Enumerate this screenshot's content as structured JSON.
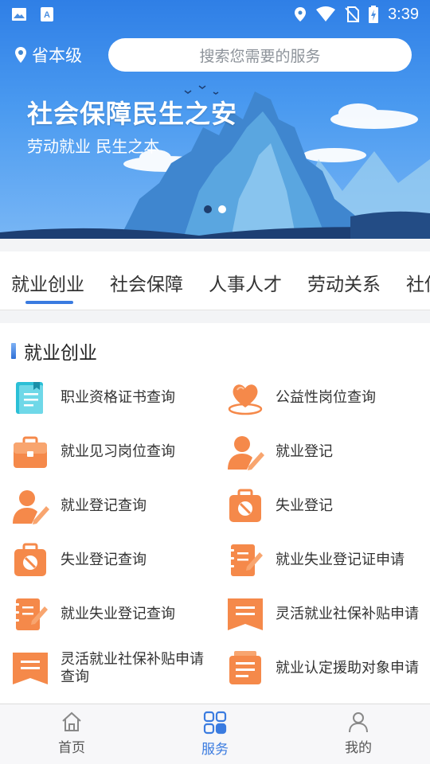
{
  "status_bar": {
    "time": "3:39"
  },
  "header": {
    "location": "省本级",
    "search_placeholder": "搜索您需要的服务"
  },
  "banner": {
    "title": "社会保障民生之安",
    "subtitle": "劳动就业 民生之本",
    "slide_count": 2,
    "active_slide": 1
  },
  "tabs": [
    "就业创业",
    "社会保障",
    "人事人才",
    "劳动关系",
    "社保"
  ],
  "active_tab": 0,
  "section": {
    "title": "就业创业",
    "items": [
      {
        "label": "职业资格证书查询",
        "icon": "certificate-icon",
        "color": "#2bbfd6"
      },
      {
        "label": "公益性岗位查询",
        "icon": "heart-hand-icon",
        "color": "#f5894a"
      },
      {
        "label": "就业见习岗位查询",
        "icon": "briefcase-icon",
        "color": "#f5894a"
      },
      {
        "label": "就业登记",
        "icon": "person-pen-icon",
        "color": "#f5894a"
      },
      {
        "label": "就业登记查询",
        "icon": "person-pen-icon",
        "color": "#f5894a"
      },
      {
        "label": "失业登记",
        "icon": "bag-block-icon",
        "color": "#f5894a"
      },
      {
        "label": "失业登记查询",
        "icon": "bag-block-icon",
        "color": "#f5894a"
      },
      {
        "label": "就业失业登记证申请",
        "icon": "notepad-pen-icon",
        "color": "#f5894a"
      },
      {
        "label": "就业失业登记查询",
        "icon": "notepad-pen-icon",
        "color": "#f5894a"
      },
      {
        "label": "灵活就业社保补贴申请",
        "icon": "bookmark-icon",
        "color": "#f5894a"
      },
      {
        "label": "灵活就业社保补贴申请查询",
        "icon": "bookmark-icon",
        "color": "#f5894a"
      },
      {
        "label": "就业认定援助对象申请",
        "icon": "document-stack-icon",
        "color": "#f5894a"
      }
    ]
  },
  "bottom_nav": [
    {
      "label": "首页",
      "icon": "home-icon"
    },
    {
      "label": "服务",
      "icon": "grid-icon"
    },
    {
      "label": "我的",
      "icon": "user-icon"
    }
  ],
  "active_nav": 1,
  "colors": {
    "accent": "#3a7be0",
    "icon_orange": "#f5894a",
    "icon_teal": "#2bbfd6"
  }
}
